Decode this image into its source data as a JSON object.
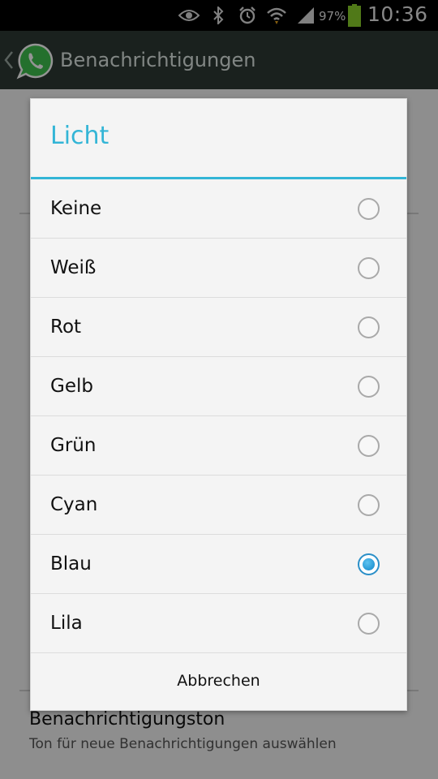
{
  "status_bar": {
    "battery_percent": "97%",
    "time": "10:36",
    "icons": [
      "eye-icon",
      "bluetooth-icon",
      "alarm-icon",
      "wifi-icon",
      "signal-icon",
      "battery-icon"
    ]
  },
  "action_bar": {
    "title": "Benachrichtigungen",
    "icons": [
      "back-chevron-icon",
      "whatsapp-logo"
    ]
  },
  "background_page": {
    "item": {
      "title": "Benachrichtigungston",
      "subtitle": "Ton für neue Benachrichtigungen auswählen"
    }
  },
  "dialog": {
    "title": "Licht",
    "options": [
      {
        "label": "Keine",
        "selected": false
      },
      {
        "label": "Weiß",
        "selected": false
      },
      {
        "label": "Rot",
        "selected": false
      },
      {
        "label": "Gelb",
        "selected": false
      },
      {
        "label": "Grün",
        "selected": false
      },
      {
        "label": "Cyan",
        "selected": false
      },
      {
        "label": "Blau",
        "selected": true
      },
      {
        "label": "Lila",
        "selected": false
      }
    ],
    "cancel_label": "Abbrechen"
  },
  "colors": {
    "accent": "#33b5d6",
    "actionbar_bg": "#2e3a35",
    "radio_selected": "#0f86c9"
  }
}
